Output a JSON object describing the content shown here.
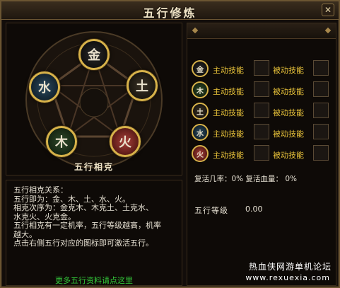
{
  "window": {
    "title": "五行修炼",
    "close_glyph": "✕"
  },
  "wheel": {
    "label": "五行相克",
    "elements": [
      {
        "name": "metal",
        "glyph": "金"
      },
      {
        "name": "earth",
        "glyph": "土"
      },
      {
        "name": "water",
        "glyph": "水"
      },
      {
        "name": "wood",
        "glyph": "木"
      },
      {
        "name": "fire",
        "glyph": "火"
      }
    ]
  },
  "description": {
    "lines": [
      "五行相克关系：",
      "五行即为：金、木、土、水、火。",
      "相克次序为：金克木、木克土、土克水、",
      "水克火、火克金。",
      "五行相克有一定机率，五行等级越高，机率",
      "越大。",
      "点击右侧五行对应的图标即可激活五行。"
    ],
    "more_link": "更多五行资料请点这里"
  },
  "skills": {
    "active_label": "主动技能",
    "passive_label": "被动技能",
    "rows": [
      {
        "element": "metal",
        "glyph": "金"
      },
      {
        "element": "wood",
        "glyph": "木"
      },
      {
        "element": "earth",
        "glyph": "土"
      },
      {
        "element": "water",
        "glyph": "水"
      },
      {
        "element": "fire",
        "glyph": "火"
      }
    ]
  },
  "stats": {
    "revive_text": "复活几率：0%  复活血量： 0%",
    "level_label": "五行等级",
    "level_value": "0.00"
  },
  "watermark": {
    "cn": "热血侠网游单机论坛",
    "url": "www.rexuexia.com"
  },
  "colors": {
    "gold_border": "#d7b24a",
    "skill_label": "#e8c23a",
    "link_green": "#33c93a"
  }
}
